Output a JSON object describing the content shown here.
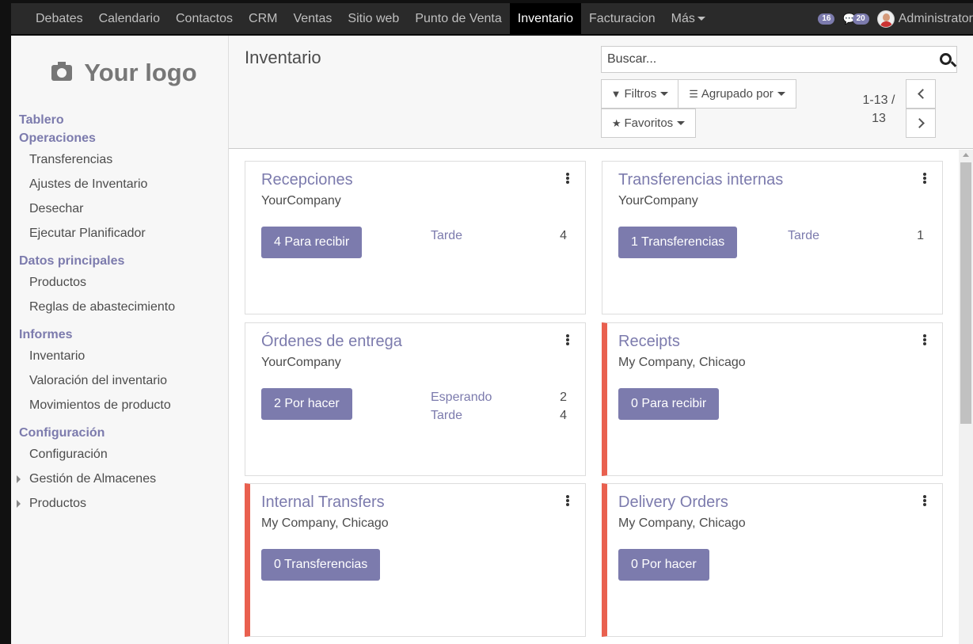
{
  "topbar": {
    "menus": [
      "Debates",
      "Calendario",
      "Contactos",
      "CRM",
      "Ventas",
      "Sitio web",
      "Punto de Venta",
      "Inventario",
      "Facturacion",
      "Más"
    ],
    "activity_count": "16",
    "message_count": "20",
    "user_name": "Administrator"
  },
  "sidebar": {
    "logo_text": "Your logo",
    "sections": {
      "tablero": "Tablero",
      "operaciones": "Operaciones",
      "datos": "Datos principales",
      "informes": "Informes",
      "configuracion": "Configuración"
    },
    "items": {
      "transferencias": "Transferencias",
      "ajustes": "Ajustes de Inventario",
      "desechar": "Desechar",
      "planificador": "Ejecutar Planificador",
      "productos": "Productos",
      "reglas": "Reglas de abastecimiento",
      "inventario": "Inventario",
      "valoracion": "Valoración del inventario",
      "movimientos": "Movimientos de producto",
      "config": "Configuración",
      "almacenes": "Gestión de Almacenes",
      "productos2": "Productos"
    }
  },
  "control_panel": {
    "title": "Inventario",
    "search_placeholder": "Buscar...",
    "filters_label": "Filtros",
    "group_label": "Agrupado por",
    "favorites_label": "Favoritos",
    "pager_range": "1-13 /",
    "pager_total": "13"
  },
  "cards": [
    {
      "title": "Recepciones",
      "company": "YourCompany",
      "button": "4 Para recibir",
      "alert": false,
      "stats": [
        {
          "label": "Tarde",
          "value": "4"
        }
      ]
    },
    {
      "title": "Transferencias internas",
      "company": "YourCompany",
      "button": "1 Transferencias",
      "alert": false,
      "stats": [
        {
          "label": "Tarde",
          "value": "1"
        }
      ]
    },
    {
      "title": "Órdenes de entrega",
      "company": "YourCompany",
      "button": "2 Por hacer",
      "alert": false,
      "stats": [
        {
          "label": "Esperando",
          "value": "2"
        },
        {
          "label": "Tarde",
          "value": "4"
        }
      ]
    },
    {
      "title": "Receipts",
      "company": "My Company, Chicago",
      "button": "0 Para recibir",
      "alert": true,
      "stats": []
    },
    {
      "title": "Internal Transfers",
      "company": "My Company, Chicago",
      "button": "0 Transferencias",
      "alert": true,
      "stats": []
    },
    {
      "title": "Delivery Orders",
      "company": "My Company, Chicago",
      "button": "0 Por hacer",
      "alert": true,
      "stats": []
    }
  ],
  "colors": {
    "accent": "#7c7bad",
    "alert": "#e9604f",
    "topbar": "#2a2a2a"
  }
}
